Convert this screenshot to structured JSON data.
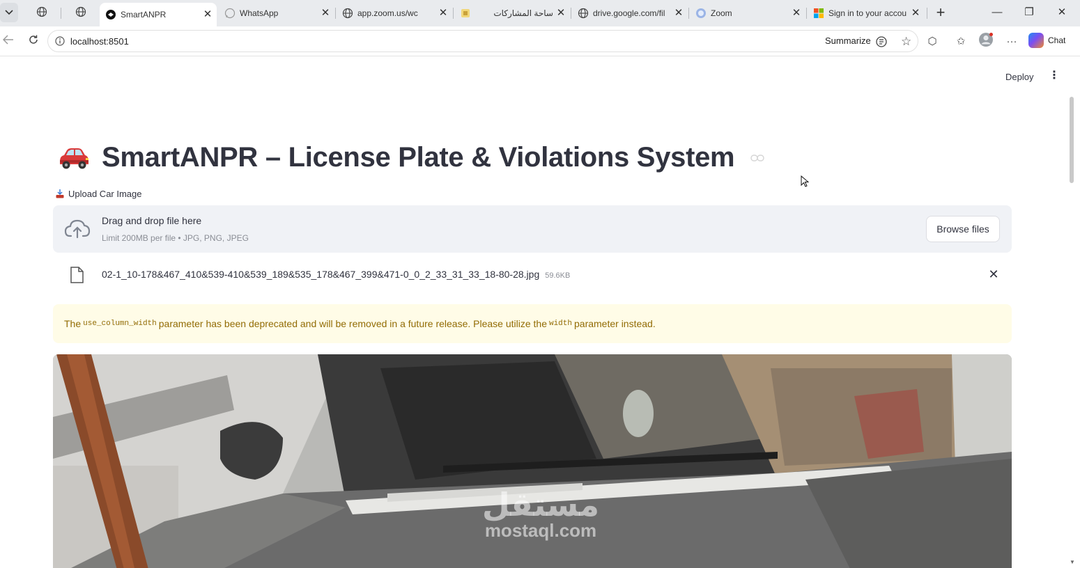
{
  "browser": {
    "tabs": [
      {
        "title": "SmartANPR",
        "active": true,
        "icon": "streamlit-icon"
      },
      {
        "title": "WhatsApp",
        "active": false,
        "icon": "whatsapp-icon"
      },
      {
        "title": "app.zoom.us/wc",
        "active": false,
        "icon": "globe-icon"
      },
      {
        "title": "ساحة المشاركات",
        "active": false,
        "icon": "site-icon"
      },
      {
        "title": "drive.google.com/fil",
        "active": false,
        "icon": "globe-icon"
      },
      {
        "title": "Zoom",
        "active": false,
        "icon": "zoom-icon"
      },
      {
        "title": "Sign in to your accou",
        "active": false,
        "icon": "microsoft-icon"
      }
    ],
    "url": "localhost:8501",
    "summarize_label": "Summarize",
    "chat_label": "Chat"
  },
  "app": {
    "deploy_label": "Deploy",
    "title": "SmartANPR – License Plate & Violations System",
    "uploader": {
      "label": "Upload Car Image",
      "drag_text": "Drag and drop file here",
      "limit_text": "Limit 200MB per file • JPG, PNG, JPEG",
      "browse_label": "Browse files"
    },
    "file": {
      "name": "02-1_10-178&467_410&539-410&539_189&535_178&467_399&471-0_0_2_33_31_33_18-80-28.jpg",
      "size": "59.6KB"
    },
    "warning": {
      "part1": "The",
      "code1": "use_column_width",
      "part2": "parameter has been deprecated and will be removed in a future release. Please utilize the",
      "code2": "width",
      "part3": "parameter instead."
    },
    "watermark": {
      "arabic": "مستقل",
      "latin": "mostaql.com"
    }
  },
  "colors": {
    "warning_bg": "#fffce7",
    "warning_text": "#926c05",
    "dropzone_bg": "#f0f2f6",
    "text": "#31333f"
  }
}
